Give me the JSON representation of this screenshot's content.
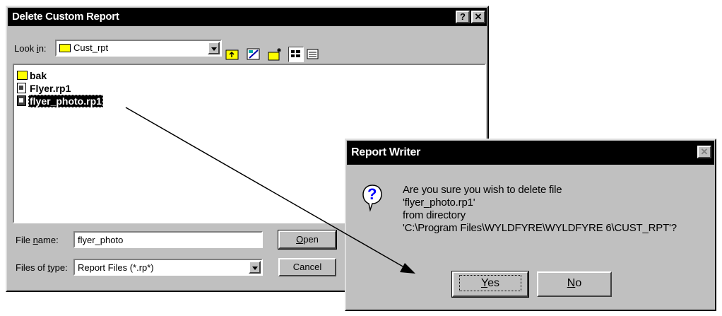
{
  "file_dialog": {
    "title": "Delete Custom Report",
    "help_glyph": "?",
    "close_glyph": "✕",
    "look_in_label_pre": "Look ",
    "look_in_label_ul": "i",
    "look_in_label_post": "n:",
    "look_in_value": "Cust_rpt",
    "items": [
      {
        "label": "bak",
        "type": "folder"
      },
      {
        "label": "Flyer.rp1",
        "type": "report-file"
      },
      {
        "label": "flyer_photo.rp1",
        "type": "report-file",
        "selected": true
      }
    ],
    "file_name_label_pre": "File ",
    "file_name_label_ul": "n",
    "file_name_label_post": "ame:",
    "file_name_value": "flyer_photo",
    "files_of_type_label_pre": "Files of ",
    "files_of_type_label_ul": "t",
    "files_of_type_label_post": "ype:",
    "files_of_type_value": "Report Files (*.rp*)",
    "open_ul": "O",
    "open_rest": "pen",
    "cancel_label": "Cancel"
  },
  "confirm_dialog": {
    "title": "Report Writer",
    "close_glyph": "✕",
    "icon_glyph": "?",
    "message_lines": [
      "Are you sure you wish to delete file",
      "'flyer_photo.rp1'",
      "from directory",
      "'C:\\Program Files\\WYLDFYRE\\WYLDFYRE 6\\CUST_RPT'?"
    ],
    "yes_ul": "Y",
    "yes_rest": "es",
    "no_ul": "N",
    "no_rest": "o"
  },
  "colors": {
    "dialog_face": "#c0c0c0",
    "titlebar": "#000000",
    "selection": "#000000",
    "folder": "#ffff00",
    "question_icon": "#0000ff"
  }
}
